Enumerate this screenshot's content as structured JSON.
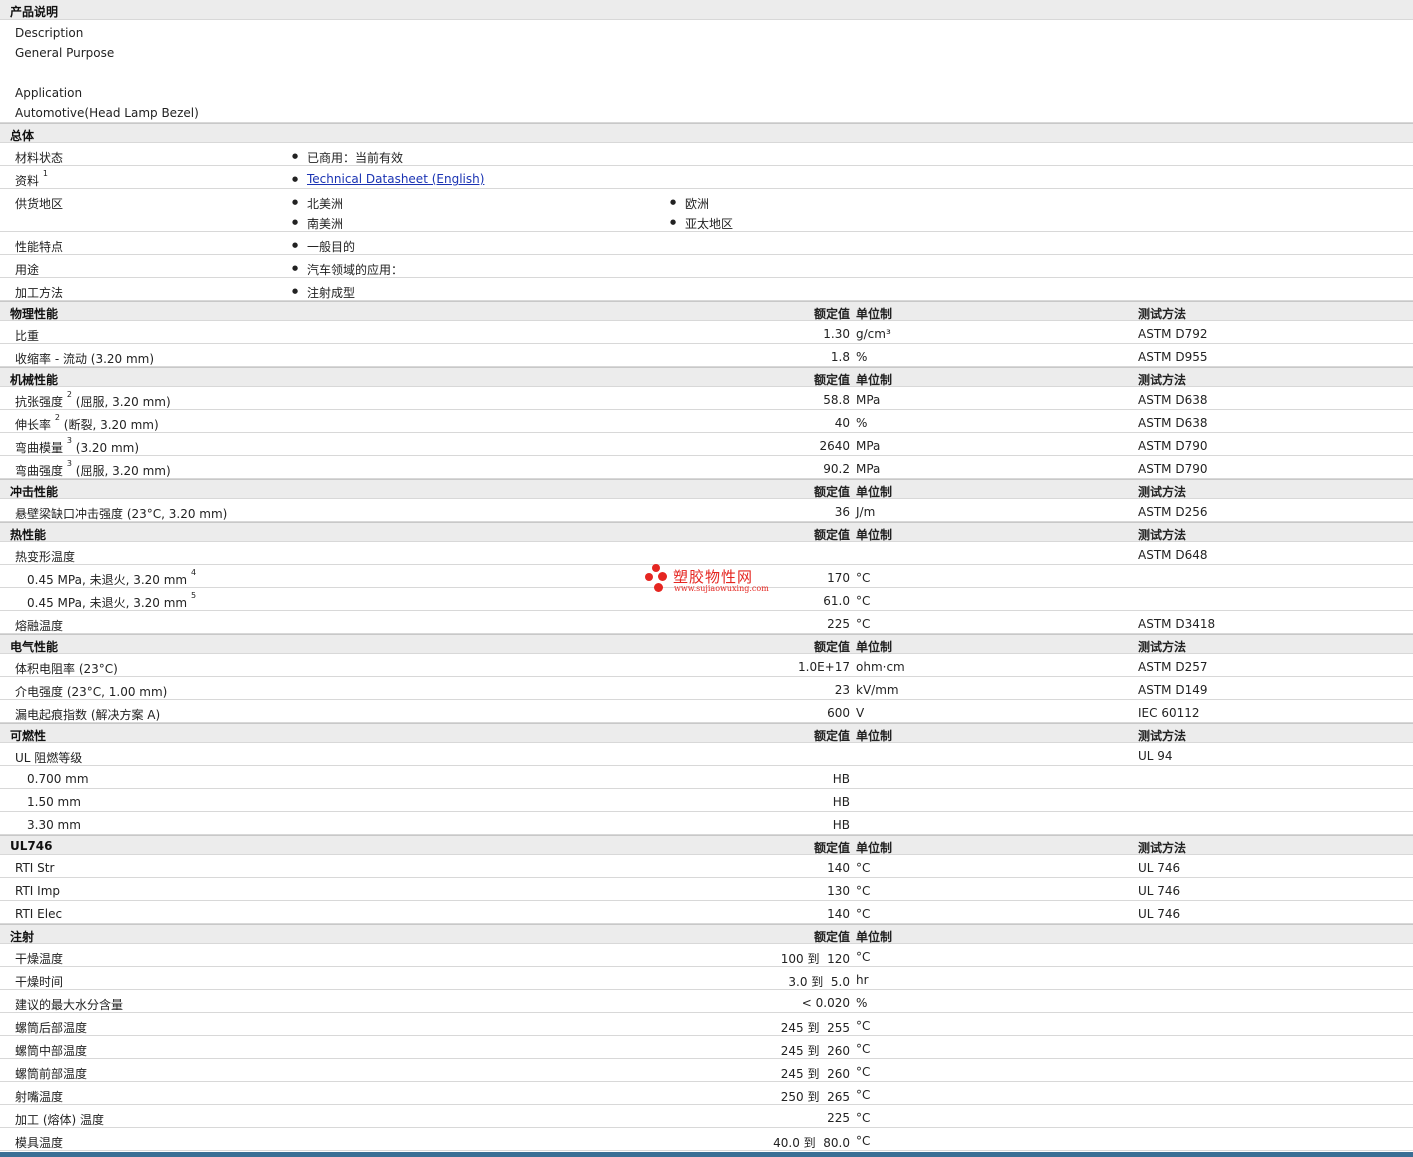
{
  "desc_section": {
    "title": "产品说明",
    "lines": [
      "Description",
      "General Purpose",
      "",
      "Application",
      "Automotive(Head Lamp Bezel)"
    ]
  },
  "general": {
    "title": "总体",
    "status_label": "材料状态",
    "status_value": "已商用：当前有效",
    "docs_label": "资料",
    "docs_sup": "1",
    "docs_link": "Technical Datasheet (English)",
    "supply_label": "供货地区",
    "supply": [
      "北美洲",
      "欧洲",
      "南美洲",
      "亚太地区"
    ],
    "features_label": "性能特点",
    "features_value": "一般目的",
    "uses_label": "用途",
    "uses_value": "汽车领域的应用：",
    "process_label": "加工方法",
    "process_value": "注射成型"
  },
  "col_headers": {
    "nominal": "额定值",
    "unit": "单位制",
    "method": "测试方法"
  },
  "sections": [
    {
      "title": "物理性能",
      "method_header": true,
      "rows": [
        {
          "label": "比重",
          "value": "1.30",
          "unit": "g/cm³",
          "method": "ASTM D792"
        },
        {
          "label": "收缩率 - 流动 (3.20 mm)",
          "value": "1.8",
          "unit": "%",
          "method": "ASTM D955"
        }
      ]
    },
    {
      "title": "机械性能",
      "method_header": true,
      "rows": [
        {
          "label": "抗张强度",
          "sup": "2",
          "suffix": "(屈服, 3.20 mm)",
          "value": "58.8",
          "unit": "MPa",
          "method": "ASTM D638"
        },
        {
          "label": "伸长率",
          "sup": "2",
          "suffix": "(断裂, 3.20 mm)",
          "value": "40",
          "unit": "%",
          "method": "ASTM D638"
        },
        {
          "label": "弯曲模量",
          "sup": "3",
          "suffix": "(3.20 mm)",
          "value": "2640",
          "unit": "MPa",
          "method": "ASTM D790"
        },
        {
          "label": "弯曲强度",
          "sup": "3",
          "suffix": "(屈服, 3.20 mm)",
          "value": "90.2",
          "unit": "MPa",
          "method": "ASTM D790"
        }
      ]
    },
    {
      "title": "冲击性能",
      "method_header": true,
      "rows": [
        {
          "label": "悬壁梁缺口冲击强度 (23°C, 3.20 mm)",
          "value": "36",
          "unit": "J/m",
          "method": "ASTM D256"
        }
      ]
    },
    {
      "title": "热性能",
      "method_header": true,
      "rows": [
        {
          "label": "热变形温度",
          "value": "",
          "unit": "",
          "method": "ASTM D648"
        },
        {
          "label": "0.45 MPa, 未退火, 3.20 mm",
          "sup": "4",
          "indent": true,
          "value": "170",
          "unit": "°C",
          "method": ""
        },
        {
          "label": "0.45 MPa, 未退火, 3.20 mm",
          "sup": "5",
          "indent": true,
          "value": "61.0",
          "unit": "°C",
          "method": ""
        },
        {
          "label": "熔融温度",
          "value": "225",
          "unit": "°C",
          "method": "ASTM D3418"
        }
      ]
    },
    {
      "title": "电气性能",
      "method_header": true,
      "rows": [
        {
          "label": "体积电阻率 (23°C)",
          "value": "1.0E+17",
          "unit": "ohm·cm",
          "method": "ASTM D257"
        },
        {
          "label": "介电强度 (23°C, 1.00 mm)",
          "value": "23",
          "unit": "kV/mm",
          "method": "ASTM D149"
        },
        {
          "label": "漏电起痕指数 (解决方案 A)",
          "value": "600",
          "unit": "V",
          "method": "IEC 60112"
        }
      ]
    },
    {
      "title": "可燃性",
      "method_header": true,
      "rows": [
        {
          "label": "UL 阻燃等级",
          "value": "",
          "unit": "",
          "method": "UL 94"
        },
        {
          "label": "0.700 mm",
          "indent": true,
          "value": "HB",
          "unit": "",
          "method": ""
        },
        {
          "label": "1.50 mm",
          "indent": true,
          "value": "HB",
          "unit": "",
          "method": ""
        },
        {
          "label": "3.30 mm",
          "indent": true,
          "value": "HB",
          "unit": "",
          "method": ""
        }
      ]
    },
    {
      "title": "UL746",
      "method_header": true,
      "rows": [
        {
          "label": "RTI Str",
          "value": "140",
          "unit": "°C",
          "method": "UL 746"
        },
        {
          "label": "RTI Imp",
          "value": "130",
          "unit": "°C",
          "method": "UL 746"
        },
        {
          "label": "RTI Elec",
          "value": "140",
          "unit": "°C",
          "method": "UL 746"
        }
      ]
    },
    {
      "title": "注射",
      "method_header": false,
      "rows": [
        {
          "label": "干燥温度",
          "value": "100 到  120",
          "unit": "°C",
          "method": ""
        },
        {
          "label": "干燥时间",
          "value": "3.0 到  5.0",
          "unit": "hr",
          "method": ""
        },
        {
          "label": "建议的最大水分含量",
          "value": "< 0.020",
          "unit": "%",
          "method": ""
        },
        {
          "label": "螺筒后部温度",
          "value": "245 到  255",
          "unit": "°C",
          "method": ""
        },
        {
          "label": "螺筒中部温度",
          "value": "245 到  260",
          "unit": "°C",
          "method": ""
        },
        {
          "label": "螺筒前部温度",
          "value": "245 到  260",
          "unit": "°C",
          "method": ""
        },
        {
          "label": "射嘴温度",
          "value": "250 到  265",
          "unit": "°C",
          "method": ""
        },
        {
          "label": "加工 (熔体) 温度",
          "value": "225",
          "unit": "°C",
          "method": ""
        },
        {
          "label": "模具温度",
          "value": "40.0 到  80.0",
          "unit": "°C",
          "method": ""
        }
      ]
    }
  ],
  "watermark": {
    "title": "塑胶物性网",
    "url": "www.sujiaowuxing.com"
  }
}
